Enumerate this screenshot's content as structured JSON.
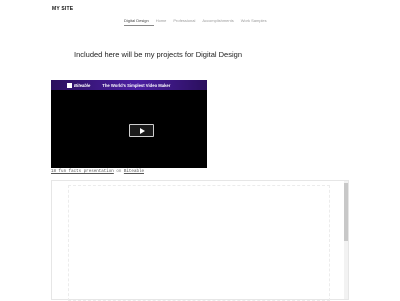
{
  "site": {
    "title": "MY SITE"
  },
  "nav": {
    "items": [
      {
        "label": "Digital Design"
      },
      {
        "label": "Home"
      },
      {
        "label": "Professional"
      },
      {
        "label": "Accomplishments"
      },
      {
        "label": "Work Samples"
      }
    ],
    "active_index": 0
  },
  "main": {
    "heading": "Included here will be my projects for Digital Design"
  },
  "video": {
    "brand": "Biteable",
    "title": "The World's Simplest Video Maker",
    "play_icon": "play-icon"
  },
  "caption": {
    "link_text": "18 fun facts presentation",
    "on_text": "on",
    "source_text": "Biteable"
  },
  "colors": {
    "video_banner": "#4c1fa3",
    "video_background": "#000000"
  }
}
